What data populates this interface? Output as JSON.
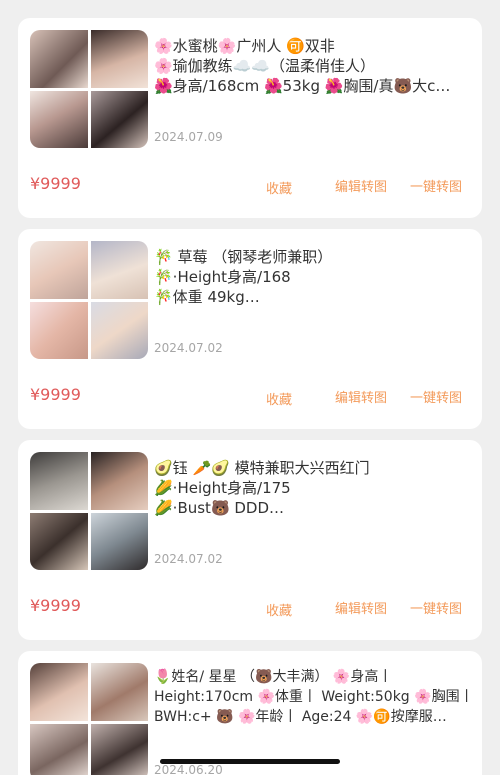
{
  "cards": [
    {
      "lines": [
        "🌸水蜜桃🌸广州人 🉑双非",
        "🌸瑜伽教练☁️☁️（温柔俏佳人）",
        "🌺身高/168cm  🌺53kg 🌺胸围/真🐻大c…"
      ],
      "date": "2024.07.09",
      "price": "¥9999",
      "fav": "收藏",
      "edit": "编辑转图",
      "oneclick": "一键转图"
    },
    {
      "lines": [
        "🎋 草莓 （钢琴老师兼职）",
        "🎋·Height身高/168",
        "🎋体重 49kg…"
      ],
      "date": "2024.07.02",
      "price": "¥9999",
      "fav": "收藏",
      "edit": "编辑转图",
      "oneclick": "一键转图"
    },
    {
      "lines": [
        "🥑钰 🥕🥑 模特兼职大兴西红门",
        "🌽·Height身高/175",
        "🌽·Bust🐻 DDD…"
      ],
      "date": "2024.07.02",
      "price": "¥9999",
      "fav": "收藏",
      "edit": "编辑转图",
      "oneclick": "一键转图"
    },
    {
      "lines": [
        "🌷姓名/  星星 （🐻大丰满） 🌸身高丨",
        "Height:170cm 🌸体重丨 Weight:50kg 🌸胸围丨",
        "BWH:c+  🐻 🌸年龄丨 Age:24 🌸🉑按摩服…"
      ],
      "date": "2024.06.20"
    }
  ]
}
